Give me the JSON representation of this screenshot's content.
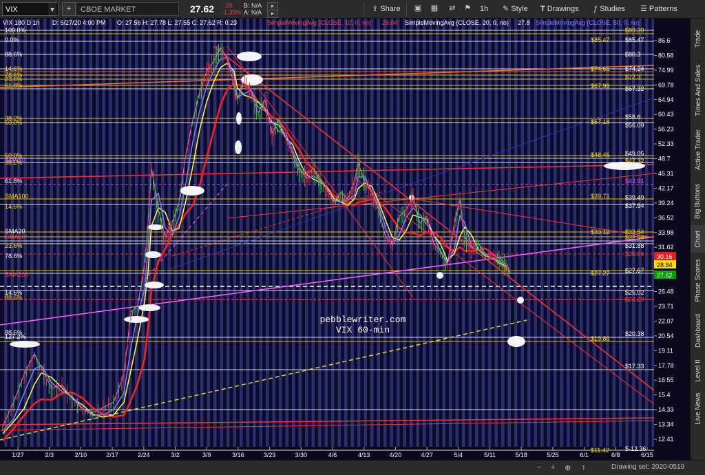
{
  "toolbar": {
    "symbol": "VIX",
    "name": "CBOE MARKET VOLATILITY INDEX",
    "price": "27.62",
    "change": "-.39",
    "change_pct": "-1.39%",
    "bid": "B: N/A",
    "ask": "A: N/A",
    "share": "Share",
    "timeframe": "1h",
    "style": "Style",
    "drawings": "Drawings",
    "studies": "Studies",
    "patterns": "Patterns"
  },
  "header": {
    "symbol_line": "VIX 180 D 1h",
    "date": "D: 5/27/20 4:00 PM",
    "ohlc": "O: 27.56  H: 27.78  L: 27.55  C: 27.62  R: 0.23",
    "sma10": "SimpleMovingAvg (CLOSE, 10, 0, no)",
    "sma10_val": "28.04",
    "sma20": "SimpleMovingAvg (CLOSE, 20, 0, no)",
    "sma20_val": "27.8",
    "sma50": "SimpleMovingAvg (CLOSE, 50, 0, no)"
  },
  "left_labels": [
    {
      "t": "100.0%",
      "c": "#ffffff"
    },
    {
      "t": "0.0%",
      "c": "#ffffff"
    },
    {
      "t": "88.6%",
      "c": "#ffffff"
    },
    {
      "t": "14.6%",
      "c": "#ffdd00"
    },
    {
      "t": "78.6%",
      "c": "#ffdd00"
    },
    {
      "t": "23.6%",
      "c": "#ffdd00"
    },
    {
      "t": "61.8%",
      "c": "#ffdd00"
    },
    {
      "t": "38.2%",
      "c": "#ffdd00"
    },
    {
      "t": "50.0%",
      "c": "#ffdd00"
    },
    {
      "t": "50.0%",
      "c": "#ffdd00"
    },
    {
      "t": "SMA50",
      "c": "#e060ff"
    },
    {
      "t": "38.2%",
      "c": "#ffdd00"
    },
    {
      "t": "61.8%",
      "c": "#ffffff"
    },
    {
      "t": "SMA100",
      "c": "#ffdd00"
    },
    {
      "t": "14.6%",
      "c": "#ffdd00"
    },
    {
      "t": "SMA20",
      "c": "#ffffff"
    },
    {
      "t": "SMA10",
      "c": "#ff4444"
    },
    {
      "t": "23.6%",
      "c": "#ffdd00"
    },
    {
      "t": "78.6%",
      "c": "#ffffff"
    },
    {
      "t": "SMA200",
      "c": "#ff4444"
    },
    {
      "t": "14.6%",
      "c": "#ffffff"
    },
    {
      "t": "88.6%",
      "c": "#ffdd00"
    },
    {
      "t": "88.6%",
      "c": "#ffffff"
    },
    {
      "t": "127.2%",
      "c": "#ffffff"
    }
  ],
  "fib_labels": [
    {
      "t": "$85.47",
      "c": "#ffdd00"
    },
    {
      "t": "$74.66",
      "c": "#ffdd00"
    },
    {
      "t": "$67.99",
      "c": "#ffdd00"
    },
    {
      "t": "$57.18",
      "c": "#ffdd00"
    },
    {
      "t": "$48.45",
      "c": "#ffdd00"
    },
    {
      "t": "$39.71",
      "c": "#ffdd00"
    },
    {
      "t": "$33.12",
      "c": "#ffdd00"
    },
    {
      "t": "$27.27",
      "c": "#ffdd00"
    },
    {
      "t": "$19.86",
      "c": "#ffdd00"
    },
    {
      "t": "$11.42",
      "c": "#ffdd00"
    }
  ],
  "right_labels": [
    {
      "t": "$89.39",
      "c": "#ffdd00"
    },
    {
      "t": "$85.47",
      "c": "#ffffff"
    },
    {
      "t": "$80.3",
      "c": "#ffffff"
    },
    {
      "t": "$74.24",
      "c": "#ffffff"
    },
    {
      "t": "$72.3",
      "c": "#ffdd00"
    },
    {
      "t": "$67.32",
      "c": "#ffffff"
    },
    {
      "t": "$58.6",
      "c": "#ffffff"
    },
    {
      "t": "$56.09",
      "c": "#ffffff"
    },
    {
      "t": "$49.05",
      "c": "#ffffff"
    },
    {
      "t": "$47.32",
      "c": "#ffdd00"
    },
    {
      "t": "$42.91",
      "c": "#e060ff"
    },
    {
      "t": "$39.49",
      "c": "#ffffff"
    },
    {
      "t": "$37.94",
      "c": "#ffffff"
    },
    {
      "t": "$33.54",
      "c": "#ffdd00"
    },
    {
      "t": "$32.54",
      "c": "#ffdd00"
    },
    {
      "t": "$31.88",
      "c": "#ffffff"
    },
    {
      "t": "$29.94",
      "c": "#ff4444"
    },
    {
      "t": "$27.67",
      "c": "#ffffff"
    },
    {
      "t": "$25.02",
      "c": "#ffffff"
    },
    {
      "t": "$24.29",
      "c": "#ff4444"
    },
    {
      "t": "$20.38",
      "c": "#ffffff"
    },
    {
      "t": "$17.33",
      "c": "#ffffff"
    },
    {
      "t": "$-12.36",
      "c": "#ffffff"
    }
  ],
  "price_axis": [
    "86.6",
    "80.58",
    "74.99",
    "69.78",
    "64.94",
    "60.43",
    "56.23",
    "52.33",
    "48.7",
    "45.31",
    "42.17",
    "39.24",
    "36.52",
    "33.98",
    "31.62",
    "29.43",
    "27.38",
    "25.48",
    "23.71",
    "22.07",
    "20.54",
    "19.11",
    "17.78",
    "16.55",
    "15.4",
    "14.33",
    "13.34",
    "12.41"
  ],
  "price_flags": [
    {
      "t": "30.16",
      "bg": "#e02020",
      "fg": "#ffffff"
    },
    {
      "t": "28.84",
      "bg": "#ffdd00",
      "fg": "#000000"
    },
    {
      "t": "27.62",
      "bg": "#00a000",
      "fg": "#ffffff"
    }
  ],
  "date_axis": [
    "1/27",
    "2/3",
    "2/10",
    "2/17",
    "2/24",
    "3/2",
    "3/9",
    "3/16",
    "3/23",
    "3/30",
    "4/6",
    "4/13",
    "4/20",
    "4/27",
    "5/4",
    "5/11",
    "5/18",
    "5/25",
    "6/1",
    "6/8",
    "6/15"
  ],
  "watermark": {
    "line1": "pebblewriter.com",
    "line2": "VIX 60-min"
  },
  "right_tabs": [
    "Trade",
    "Times And Sales",
    "Active Trader",
    "Big Buttons",
    "Chart",
    "Phase Scores",
    "Dashboard",
    "Level II",
    "Live News"
  ],
  "status": {
    "drawing_set": "Drawing set: 2020-0519"
  },
  "colors": {
    "background": "#0b0b2e",
    "fib_yellow": "#ffdd00",
    "sma10": "#ff2020",
    "sma20": "#ffff40",
    "sma50": "#8080ff",
    "magenta": "#ff60ff"
  }
}
